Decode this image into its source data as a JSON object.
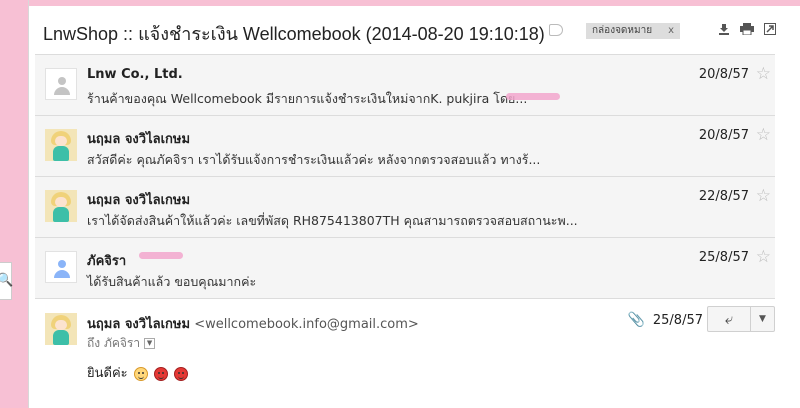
{
  "subject": "LnwShop :: แจ้งชำระเงิน Wellcomebook (2014-08-20 19:10:18)",
  "label_chip": "กล่องจดหมาย",
  "label_close": "x",
  "toolbar": {
    "download_icon": "download-icon",
    "print_icon": "print-icon",
    "newwindow_icon": "new-window-icon"
  },
  "messages": [
    {
      "sender": "Lnw Co., Ltd.",
      "snippet": "ร้านค้าของคุณ Wellcomebook มีรายการแจ้งชำระเงินใหม่จากK. pukjira โดย...",
      "date": "20/8/57",
      "avatar": "default-avatar"
    },
    {
      "sender": "นฤมล จงวิไลเกษม",
      "snippet": "สวัสดีค่ะ คุณภัคจิรา เราได้รับแจ้งการชำระเงินแล้วค่ะ หลังจากตรวจสอบแล้ว ทางร้...",
      "date": "20/8/57",
      "avatar": "character-avatar"
    },
    {
      "sender": "นฤมล จงวิไลเกษม",
      "snippet": "เราได้จัดส่งสินค้าให้แล้วค่ะ เลขที่พัสดุ RH875413807TH คุณสามารถตรวจสอบสถานะพ...",
      "date": "22/8/57",
      "avatar": "character-avatar"
    },
    {
      "sender": "ภัคจิรา",
      "snippet": "ได้รับสินค้าแล้ว ขอบคุณมากค่ะ",
      "date": "25/8/57",
      "avatar": "contact-avatar"
    }
  ],
  "expanded": {
    "sender": "นฤมล จงวิไลเกษม",
    "email": "<wellcomebook.info@gmail.com>",
    "to": "ถึง ภัคจิรา",
    "date": "25/8/57",
    "body": "ยินดีค่ะ",
    "emojis": [
      "smile-emoji",
      "love-emoji",
      "love-emoji"
    ]
  },
  "star": "☆",
  "reply_glyph": "⤶",
  "more_glyph": "▼",
  "search_glyph": "🔍",
  "clip_glyph": "📎",
  "colors": {
    "pink_bg": "#f7c0d4",
    "row_bg": "#f5f5f5",
    "redact": "#f2a6cd"
  }
}
